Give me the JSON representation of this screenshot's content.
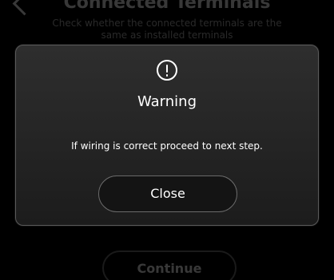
{
  "background": {
    "title": "Connected Terminals",
    "subtitle": "Check whether the connected terminals are the same as installed terminals",
    "back_icon": "chevron-left-icon",
    "continue_label": "Continue"
  },
  "modal": {
    "icon": "alert-circle-icon",
    "title": "Warning",
    "message": "If wiring is correct proceed to next step.",
    "close_label": "Close"
  }
}
